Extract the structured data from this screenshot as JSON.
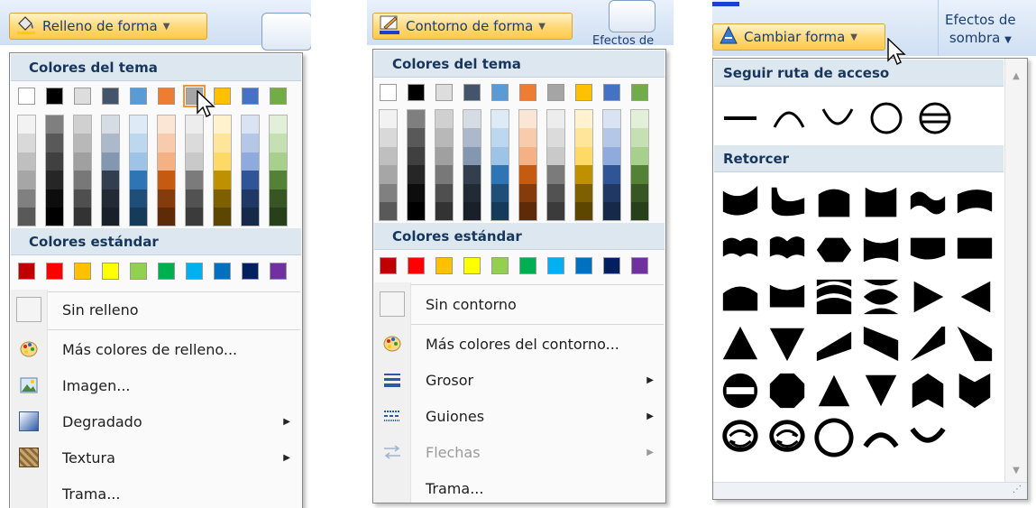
{
  "fill_panel": {
    "button_label": "Relleno de forma",
    "theme_header": "Colores del tema",
    "standard_header": "Colores estándar",
    "items": [
      {
        "label": "Sin relleno",
        "icon": "empty-box-icon",
        "submenu": false
      },
      {
        "label": "Más colores de relleno...",
        "icon": "palette-icon",
        "submenu": false
      },
      {
        "label": "Imagen...",
        "icon": "picture-icon",
        "submenu": false
      },
      {
        "label": "Degradado",
        "icon": "gradient-icon",
        "submenu": true
      },
      {
        "label": "Textura",
        "icon": "texture-icon",
        "submenu": true
      },
      {
        "label": "Trama...",
        "icon": "",
        "submenu": false
      }
    ]
  },
  "outline_panel": {
    "button_label": "Contorno de forma",
    "background_label": "Efectos de",
    "theme_header": "Colores del tema",
    "standard_header": "Colores estándar",
    "items": [
      {
        "label": "Sin contorno",
        "icon": "empty-box-icon",
        "submenu": false,
        "disabled": false
      },
      {
        "label": "Más colores del contorno...",
        "icon": "palette-icon",
        "submenu": false,
        "disabled": false
      },
      {
        "label": "Grosor",
        "icon": "line-weight-icon",
        "submenu": true,
        "disabled": false
      },
      {
        "label": "Guiones",
        "icon": "dashes-icon",
        "submenu": true,
        "disabled": false
      },
      {
        "label": "Flechas",
        "icon": "arrows-icon",
        "submenu": true,
        "disabled": true
      },
      {
        "label": "Trama...",
        "icon": "",
        "submenu": false,
        "disabled": false
      }
    ]
  },
  "shape_panel": {
    "button_label": "Cambiar forma",
    "effects_label_line1": "Efectos de",
    "effects_label_line2": "sombra",
    "section1": "Seguir ruta de acceso",
    "section2": "Retorcer"
  },
  "theme_colors": [
    "#ffffff",
    "#000000",
    "#dddddd",
    "#44546a",
    "#5b9bd5",
    "#ed7d31",
    "#a5a5a5",
    "#ffc000",
    "#4472c4",
    "#70ad47"
  ],
  "shade_columns": [
    [
      "#f2f2f2",
      "#d9d9d9",
      "#bfbfbf",
      "#a6a6a6",
      "#808080",
      "#595959"
    ],
    [
      "#7f7f7f",
      "#595959",
      "#404040",
      "#262626",
      "#0d0d0d",
      "#000000"
    ],
    [
      "#d0d0d0",
      "#b8b8b8",
      "#a0a0a0",
      "#787878",
      "#4f4f4f",
      "#333333"
    ],
    [
      "#d6dce4",
      "#adb9ca",
      "#8497b0",
      "#333f4f",
      "#222a35",
      "#1a2029"
    ],
    [
      "#deebf6",
      "#bdd7ee",
      "#9dc3e6",
      "#2e75b5",
      "#1f4e79",
      "#163a5a"
    ],
    [
      "#fbe5d5",
      "#f7cbac",
      "#f4b183",
      "#c55a11",
      "#843c0c",
      "#5f2a08"
    ],
    [
      "#ededed",
      "#dbdbdb",
      "#c9c9c9",
      "#7b7b7b",
      "#525252",
      "#3b3b3b"
    ],
    [
      "#fff2cc",
      "#fee599",
      "#ffd966",
      "#bf9000",
      "#7f6000",
      "#5c4600"
    ],
    [
      "#dae3f3",
      "#b4c7e7",
      "#8faadc",
      "#2f5597",
      "#203864",
      "#172948"
    ],
    [
      "#e2efd9",
      "#c5e0b3",
      "#a8d08d",
      "#538135",
      "#375623",
      "#28401a"
    ]
  ],
  "standard_colors": [
    "#c00000",
    "#ff0000",
    "#ffc000",
    "#ffff00",
    "#92d050",
    "#00b050",
    "#00b0f0",
    "#0070c0",
    "#002060",
    "#7030a0"
  ]
}
